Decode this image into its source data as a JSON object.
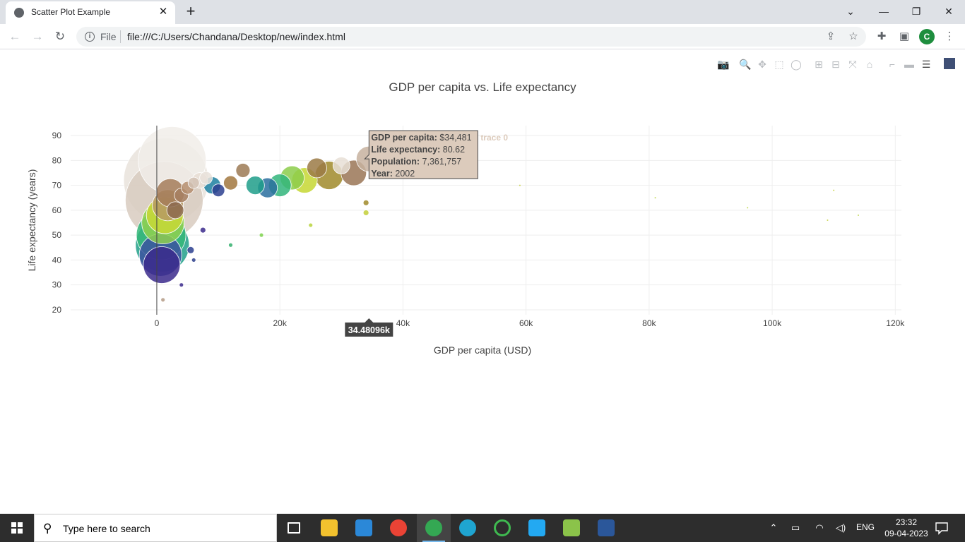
{
  "browser": {
    "tab_title": "Scatter Plot Example",
    "url_scheme": "File",
    "url": "file:///C:/Users/Chandana/Desktop/new/index.html",
    "profile_initial": "C"
  },
  "plot": {
    "title": "GDP per capita vs. Life expectancy",
    "xlabel": "GDP per capita (USD)",
    "ylabel": "Life expectancy (years)",
    "hover": {
      "gdp_label": "GDP per capita:",
      "gdp_value": "$34,481",
      "life_label": "Life expectancy:",
      "life_value": "80.62",
      "pop_label": "Population:",
      "pop_value": "7,361,757",
      "year_label": "Year:",
      "year_value": "2002",
      "trace_name": "trace 0",
      "x_spike_label": "34.48096k"
    },
    "colors": {
      "hover_bg": "#dccbbc",
      "spike_label_bg": "#444444",
      "accent_modebar_logo": "#3f4f75"
    }
  },
  "chart_data": {
    "type": "scatter",
    "title": "GDP per capita vs. Life expectancy",
    "xlabel": "GDP per capita (USD)",
    "ylabel": "Life expectancy (years)",
    "xlim": [
      -14000,
      121000
    ],
    "ylim": [
      18,
      94
    ],
    "x_ticks": [
      0,
      20000,
      40000,
      60000,
      80000,
      100000,
      120000
    ],
    "x_tick_labels": [
      "0",
      "20k",
      "40k",
      "60k",
      "80k",
      "100k",
      "120k"
    ],
    "y_ticks": [
      20,
      30,
      40,
      50,
      60,
      70,
      80,
      90
    ],
    "y_tick_labels": [
      "20",
      "30",
      "40",
      "50",
      "60",
      "70",
      "80",
      "90"
    ],
    "grid": true,
    "series": [
      {
        "marker_size_by": "population",
        "marker_color_by": "year",
        "points": [
          {
            "x": 1500,
            "y": 72,
            "r": 60,
            "c": "#e9e3dc"
          },
          {
            "x": 1200,
            "y": 64,
            "r": 55,
            "c": "#d8cbbf"
          },
          {
            "x": 2500,
            "y": 80,
            "r": 48,
            "c": "#f1ede9"
          },
          {
            "x": 900,
            "y": 46,
            "r": 38,
            "c": "#21a08a"
          },
          {
            "x": 700,
            "y": 50,
            "r": 35,
            "c": "#35b779"
          },
          {
            "x": 600,
            "y": 42,
            "r": 30,
            "c": "#3b52a0"
          },
          {
            "x": 800,
            "y": 38,
            "r": 26,
            "c": "#3b2a8c"
          },
          {
            "x": 1000,
            "y": 55,
            "r": 30,
            "c": "#8fd14f"
          },
          {
            "x": 1300,
            "y": 58,
            "r": 26,
            "c": "#c9d836"
          },
          {
            "x": 1800,
            "y": 62,
            "r": 22,
            "c": "#b79a64"
          },
          {
            "x": 2200,
            "y": 67,
            "r": 20,
            "c": "#a57c5a"
          },
          {
            "x": 3000,
            "y": 60,
            "r": 12,
            "c": "#8c6a4f"
          },
          {
            "x": 4000,
            "y": 66,
            "r": 10,
            "c": "#a67f60"
          },
          {
            "x": 5000,
            "y": 69,
            "r": 9,
            "c": "#b58e6e"
          },
          {
            "x": 6000,
            "y": 71,
            "r": 8,
            "c": "#d2c2b4"
          },
          {
            "x": 7000,
            "y": 72,
            "r": 11,
            "c": "#e7ddd4"
          },
          {
            "x": 8000,
            "y": 73,
            "r": 9,
            "c": "#e9e2db"
          },
          {
            "x": 9000,
            "y": 70,
            "r": 12,
            "c": "#1c7fa0"
          },
          {
            "x": 10000,
            "y": 68,
            "r": 9,
            "c": "#2c3f8f"
          },
          {
            "x": 12000,
            "y": 71,
            "r": 10,
            "c": "#a2783f"
          },
          {
            "x": 14000,
            "y": 76,
            "r": 10,
            "c": "#9c7a55"
          },
          {
            "x": 16000,
            "y": 70,
            "r": 13,
            "c": "#1f9e89"
          },
          {
            "x": 18000,
            "y": 69,
            "r": 14,
            "c": "#2a6f9f"
          },
          {
            "x": 20000,
            "y": 70,
            "r": 16,
            "c": "#31b57b"
          },
          {
            "x": 22000,
            "y": 73,
            "r": 17,
            "c": "#8ccd4a"
          },
          {
            "x": 24000,
            "y": 72,
            "r": 18,
            "c": "#c6d733"
          },
          {
            "x": 26000,
            "y": 77,
            "r": 14,
            "c": "#9b7a45"
          },
          {
            "x": 28000,
            "y": 74,
            "r": 20,
            "c": "#a08a2a"
          },
          {
            "x": 30000,
            "y": 78,
            "r": 12,
            "c": "#e8dfd6"
          },
          {
            "x": 32000,
            "y": 75,
            "r": 18,
            "c": "#9a7656"
          },
          {
            "x": 34481,
            "y": 80.62,
            "r": 18,
            "c": "#c7b29f"
          },
          {
            "x": 34000,
            "y": 63,
            "r": 4,
            "c": "#a08a2a"
          },
          {
            "x": 34000,
            "y": 59,
            "r": 4,
            "c": "#c3cf38"
          },
          {
            "x": 25000,
            "y": 54,
            "r": 3,
            "c": "#b9d43c"
          },
          {
            "x": 17000,
            "y": 50,
            "r": 3,
            "c": "#7ed24e"
          },
          {
            "x": 12000,
            "y": 46,
            "r": 3,
            "c": "#34b06d"
          },
          {
            "x": 6000,
            "y": 40,
            "r": 3,
            "c": "#2d3f8c"
          },
          {
            "x": 4000,
            "y": 30,
            "r": 3,
            "c": "#3b2a8c"
          },
          {
            "x": 1000,
            "y": 24,
            "r": 3,
            "c": "#b49b86"
          },
          {
            "x": 5500,
            "y": 44,
            "r": 5,
            "c": "#2c3f8f"
          },
          {
            "x": 7500,
            "y": 52,
            "r": 4,
            "c": "#3b2a8c"
          },
          {
            "x": 59000,
            "y": 70,
            "r": 1,
            "c": "#c3cf38"
          },
          {
            "x": 81000,
            "y": 65,
            "r": 1,
            "c": "#b9d43c"
          },
          {
            "x": 96000,
            "y": 61,
            "r": 1,
            "c": "#b9d43c"
          },
          {
            "x": 109000,
            "y": 56,
            "r": 1,
            "c": "#c3cf38"
          },
          {
            "x": 110000,
            "y": 68,
            "r": 1,
            "c": "#c3cf38"
          },
          {
            "x": 114000,
            "y": 58,
            "r": 1,
            "c": "#b9d43c"
          }
        ]
      }
    ]
  },
  "taskbar": {
    "search_placeholder": "Type here to search",
    "lang": "ENG",
    "time": "23:32",
    "date": "09-04-2023"
  }
}
